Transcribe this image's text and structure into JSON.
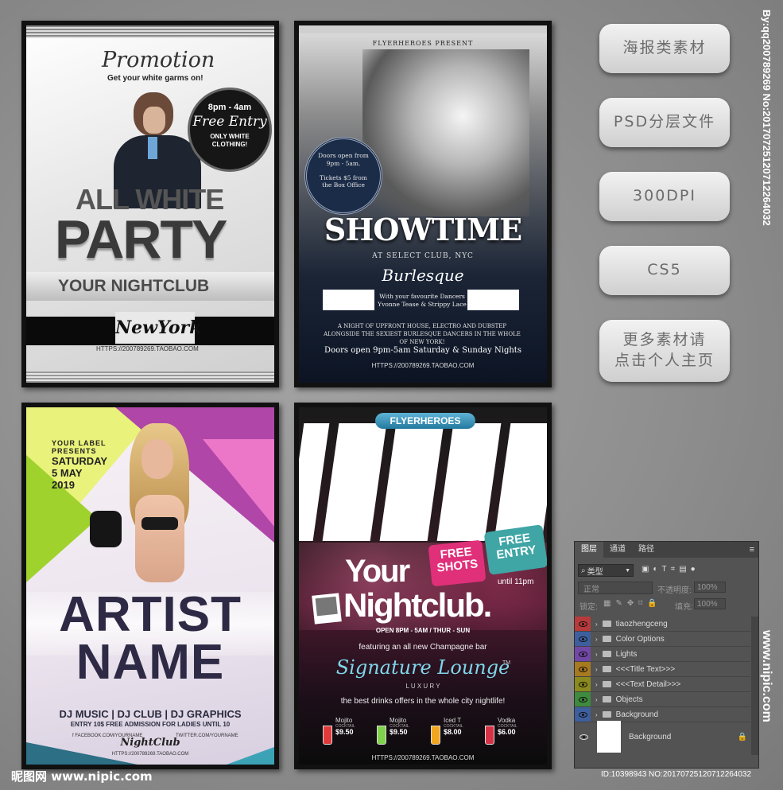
{
  "posters": {
    "p1": {
      "script_title": "Promotion",
      "tagline": "Get your white garms on!",
      "badge_time": "8pm - 4am",
      "badge_script": "Free Entry",
      "badge_note": "ONLY WHITE CLOTHING!",
      "title1": "ALL WHITE",
      "title2": "PARTY",
      "club": "YOUR NIGHTCLUB",
      "city": "NewYork",
      "url": "HTTPS://200789269.TAOBAO.COM"
    },
    "p2": {
      "presenter": "FLYERHEROES PRESENT",
      "circle_line1": "Doors open from 9pm - 5am.",
      "circle_line2": "Tickets $5 from the Box Office",
      "title": "SHOWTIME",
      "venue": "AT SELECT CLUB, NYC",
      "script": "Burlesque",
      "dancers_line1": "With your favourite Dancers",
      "dancers_line2": "Yvonne Tease & Strippy Lace",
      "desc": "A night of upfront house, electro and dubstep alongside the sexiest burlesque dancers in the whole of New York!",
      "doors": "Doors open 9pm-5am Saturday & Sunday Nights",
      "url": "HTTPS://200789269.TAOBAO.COM"
    },
    "p3": {
      "label1": "YOUR LABEL",
      "label2": "PRESENTS",
      "date1": "SATURDAY",
      "date2": "5 MAY",
      "date3": "2019",
      "title1": "ARTIST",
      "title2": "NAME",
      "lineup": "DJ MUSIC | DJ CLUB | DJ GRAPHICS",
      "entry": "ENTRY 10$ FREE ADMISSION FOR LADIES UNTIL 10",
      "facebook": "f FACEBOOK.COM/YOURNAME",
      "signature": "NightClub",
      "twitter": "TWITTER.COM/YOURNAME",
      "url": "HTTPS://200789269.TAOBAO.COM"
    },
    "p4": {
      "brand": "FLYERHEROES",
      "free_shots": "FREE SHOTS",
      "free_entry": "FREE ENTRY",
      "until": "until 11pm",
      "title1": "Your",
      "title2": "Nightclub.",
      "hours": "OPEN 8PM - 5AM / THUR - SUN",
      "featuring": "featuring an all new Champagne bar",
      "script": "Signature Lounge",
      "tm": "TM",
      "luxury": "L U X U R Y",
      "offers": "the best drinks offers in the whole city nightlife!",
      "drinks": [
        {
          "name": "Mojito",
          "sub": "COCKTAIL",
          "price": "$9.50",
          "color": "#e23a3a"
        },
        {
          "name": "Mojito",
          "sub": "COCKTAIL",
          "price": "$9.50",
          "color": "#7fd04b"
        },
        {
          "name": "Iced T",
          "sub": "COCKTAIL",
          "price": "$8.00",
          "color": "#f2a51e"
        },
        {
          "name": "Vodka",
          "sub": "COCKTAIL",
          "price": "$6.00",
          "color": "#d63246"
        }
      ],
      "url": "HTTPS://200789269.TAOBAO.COM"
    }
  },
  "pills": [
    "海报类素材",
    "PSD分层文件",
    "300DPI",
    "CS5",
    "更多素材请\n点击个人主页"
  ],
  "watermark_right": "By:qq200789269 No:20170725120712264032",
  "watermark_nipic_vertical": "www.nipic.com",
  "watermark_bottom_left": "昵图网 www.nipic.com",
  "watermark_bottom_right": "ID:10398943 NO:20170725120712264032",
  "layers_panel": {
    "tabs": [
      "图层",
      "通道",
      "路径"
    ],
    "filter_label": "类型",
    "blend_mode": "正常",
    "opacity_label": "不透明度:",
    "opacity_value": "100%",
    "lock_label": "锁定:",
    "fill_label": "填充:",
    "fill_value": "100%",
    "layers": [
      {
        "name": "tiaozhengceng",
        "color": "#b83a3a"
      },
      {
        "name": "Color Options",
        "color": "#3e5f9e"
      },
      {
        "name": "Lights",
        "color": "#7248a6"
      },
      {
        "name": "<<<Title Text>>>",
        "color": "#a87a1f"
      },
      {
        "name": "<<<Text Detail>>>",
        "color": "#8a8a1f"
      },
      {
        "name": "Objects",
        "color": "#3e8a3e"
      },
      {
        "name": "Background",
        "color": "#3e5f9e"
      }
    ],
    "base_layer": "Background"
  }
}
